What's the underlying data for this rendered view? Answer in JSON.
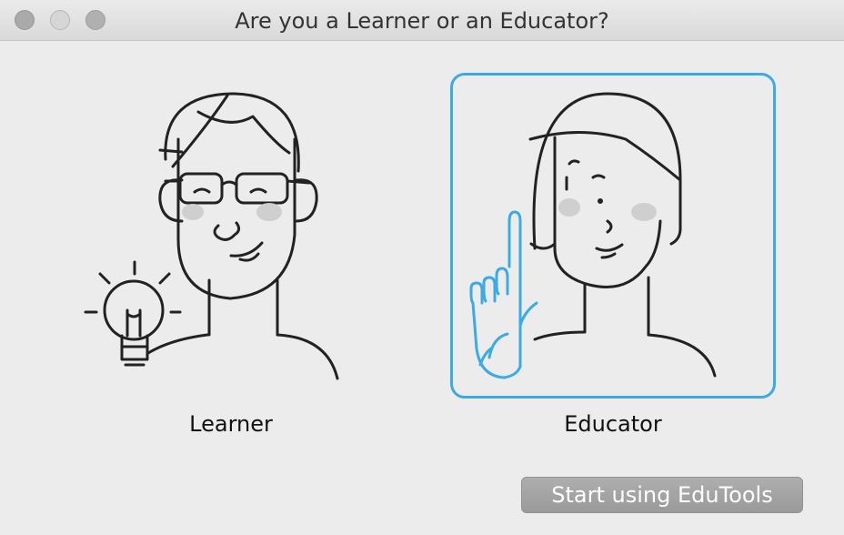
{
  "window": {
    "title": "Are you a Learner or an Educator?"
  },
  "roles": {
    "learner": {
      "label": "Learner",
      "selected": false
    },
    "educator": {
      "label": "Educator",
      "selected": true
    }
  },
  "actions": {
    "start_label": "Start using EduTools"
  },
  "colors": {
    "selection_accent": "#3aabe6",
    "line_art": "#222222",
    "cheek_shade": "#cfcfcf",
    "button_bg": "#a3a3a3"
  }
}
